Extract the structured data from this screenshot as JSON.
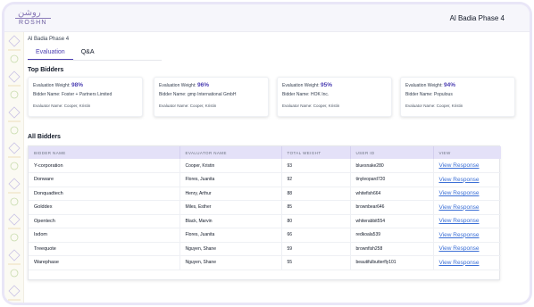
{
  "header": {
    "logo_arabic": "روشن",
    "logo_text": "ROSHN",
    "app_title": "Al Badia Phase 4"
  },
  "breadcrumb": "Al Badia Phase 4",
  "tabs": [
    {
      "label": "Evaluation",
      "active": true
    },
    {
      "label": "Q&A",
      "active": false
    }
  ],
  "top_bidders": {
    "title": "Top Bidders",
    "weight_label": "Evaluation Weight:",
    "bidder_label": "Bidder Name:",
    "evaluator_label": "Evaluator Name:",
    "cards": [
      {
        "weight": "98%",
        "bidder": "Foster + Partners Limited",
        "evaluator": "Cooper, Kristin"
      },
      {
        "weight": "96%",
        "bidder": "gmp International GmbH",
        "evaluator": "Cooper, Kristin"
      },
      {
        "weight": "95%",
        "bidder": "HOK Inc.",
        "evaluator": "Cooper, Kristin"
      },
      {
        "weight": "94%",
        "bidder": "Populous",
        "evaluator": "Cooper, Kristin"
      }
    ]
  },
  "all_bidders": {
    "title": "All Bidders",
    "columns": [
      "BIDDER NAME",
      "EVALUATOR NAME",
      "TOTAL WEIGHT",
      "USER ID",
      "VIEW"
    ],
    "rows": [
      {
        "bidder": "Y-corporation",
        "evaluator": "Cooper, Kristin",
        "weight": "93",
        "user_id": "bluesnake280",
        "view": "View Response"
      },
      {
        "bidder": "Donware",
        "evaluator": "Flores, Juanita",
        "weight": "92",
        "user_id": "tinyleopard720",
        "view": "View Response"
      },
      {
        "bidder": "Donquadtech",
        "evaluator": "Henry, Arthur",
        "weight": "88",
        "user_id": "whitefish664",
        "view": "View Response"
      },
      {
        "bidder": "Golddex",
        "evaluator": "Miles, Esther",
        "weight": "85",
        "user_id": "brownbear646",
        "view": "View Response"
      },
      {
        "bidder": "Opentech",
        "evaluator": "Black, Marvin",
        "weight": "80",
        "user_id": "whiterabbit554",
        "view": "View Response"
      },
      {
        "bidder": "Isdom",
        "evaluator": "Flores, Juanita",
        "weight": "66",
        "user_id": "redkoala539",
        "view": "View Response"
      },
      {
        "bidder": "Treequote",
        "evaluator": "Nguyen, Shane",
        "weight": "59",
        "user_id": "brownfish258",
        "view": "View Response"
      },
      {
        "bidder": "Warephase",
        "evaluator": "Nguyen, Shane",
        "weight": "55",
        "user_id": "beautifulbutterfly101",
        "view": "View Response"
      }
    ]
  },
  "colors": {
    "accent": "#4c3fb2",
    "link": "#3b6fd6",
    "header_row": "#e4e1f8",
    "frame": "#e9e6f7"
  }
}
